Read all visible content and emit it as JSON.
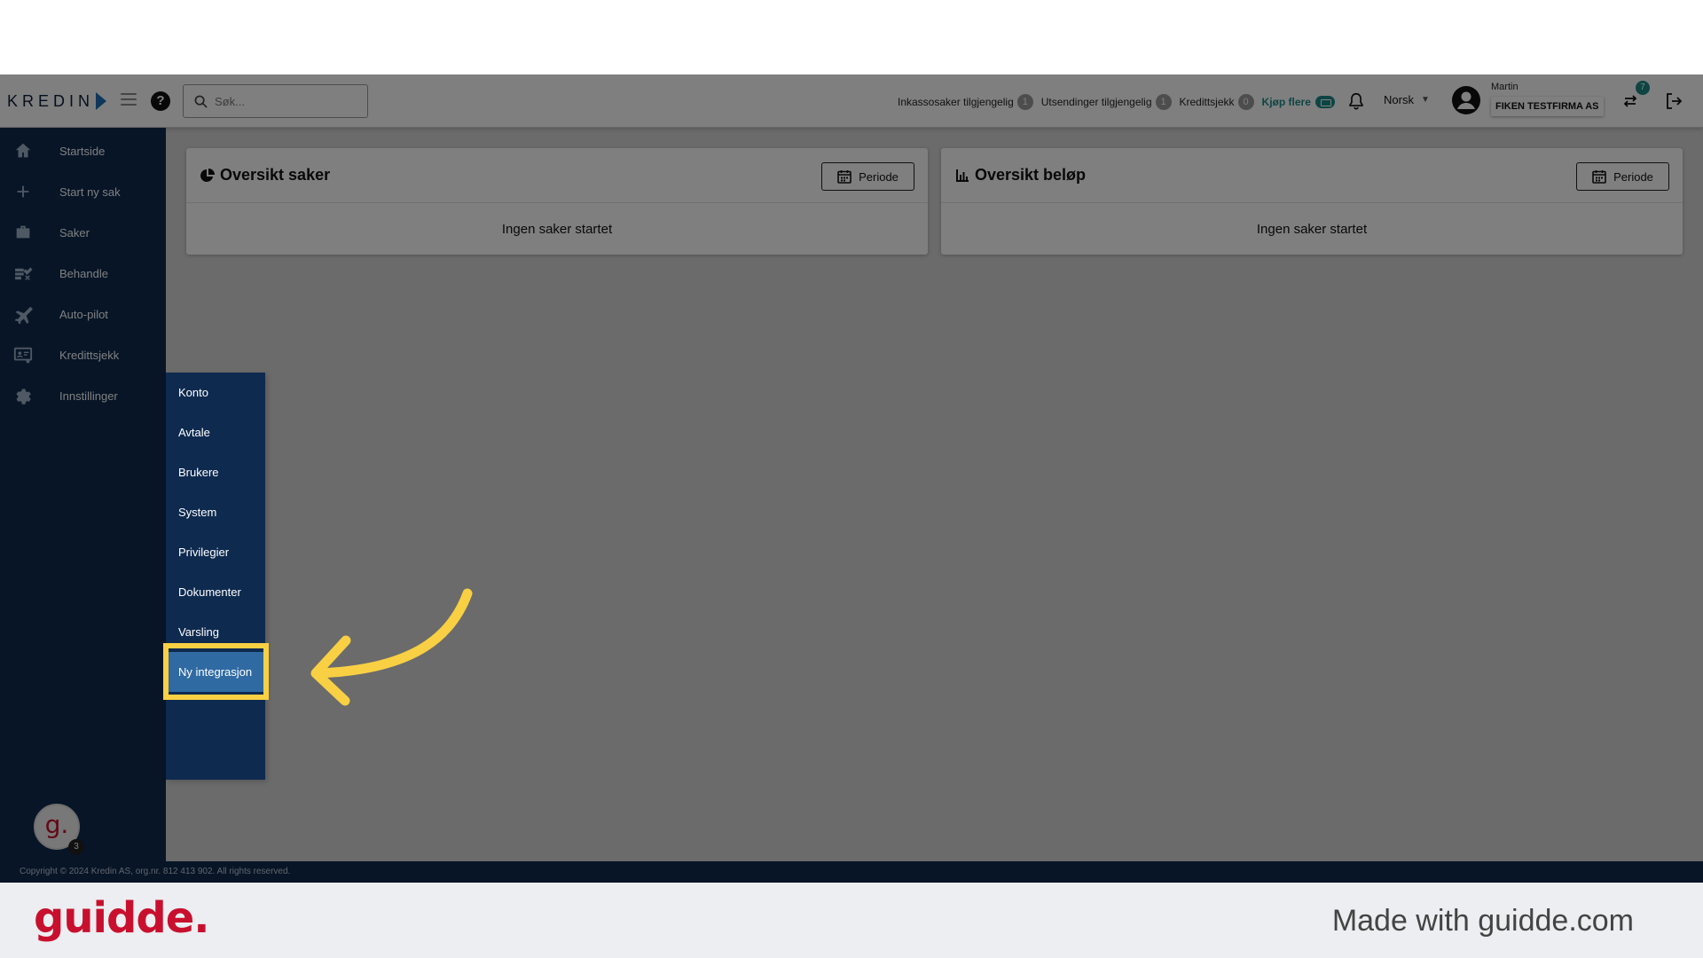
{
  "header": {
    "logo_text": "KREDIN",
    "search_placeholder": "Søk...",
    "help_glyph": "?",
    "stats": [
      {
        "label": "Inkassosaker tilgjengelig",
        "count": "1"
      },
      {
        "label": "Utsendinger tilgjengelig",
        "count": "1"
      },
      {
        "label": "Kredittsjekk",
        "count": "0"
      }
    ],
    "buy_more": "Kjøp flere",
    "language": "Norsk",
    "user_name": "Martin",
    "company": "FIKEN TESTFIRMA AS",
    "swap_badge": "7"
  },
  "sidebar": {
    "items": [
      {
        "label": "Startside",
        "icon": "home-icon"
      },
      {
        "label": "Start ny sak",
        "icon": "plus-icon"
      },
      {
        "label": "Saker",
        "icon": "briefcase-icon"
      },
      {
        "label": "Behandle",
        "icon": "checklist-icon"
      },
      {
        "label": "Auto-pilot",
        "icon": "airplane-icon"
      },
      {
        "label": "Kredittsjekk",
        "icon": "id-card-icon"
      },
      {
        "label": "Innstillinger",
        "icon": "gear-icon"
      }
    ],
    "guidde_avatar": "g.",
    "guidde_count": "3"
  },
  "submenu": {
    "items": [
      "Konto",
      "Avtale",
      "Brukere",
      "System",
      "Privilegier",
      "Dokumenter",
      "Varsling",
      "Ny integrasjon"
    ],
    "active": "Ny integrasjon"
  },
  "cards": [
    {
      "title": "Oversikt saker",
      "button": "Periode",
      "empty": "Ingen saker startet",
      "icon": "pie-chart-icon"
    },
    {
      "title": "Oversikt beløp",
      "button": "Periode",
      "empty": "Ingen saker startet",
      "icon": "bar-chart-icon"
    }
  ],
  "footer": {
    "copyright": "Copyright © 2024 Kredin AS, org.nr. 812 413 902. All rights reserved."
  },
  "branding": {
    "logo": "guidde.",
    "made_with": "Made with guidde.com"
  },
  "colors": {
    "sidebar": "#0e2a4f",
    "active_item": "#2f6aa3",
    "highlight": "#f9d043",
    "accent": "#1a8a86",
    "brand": "#c8102e"
  }
}
